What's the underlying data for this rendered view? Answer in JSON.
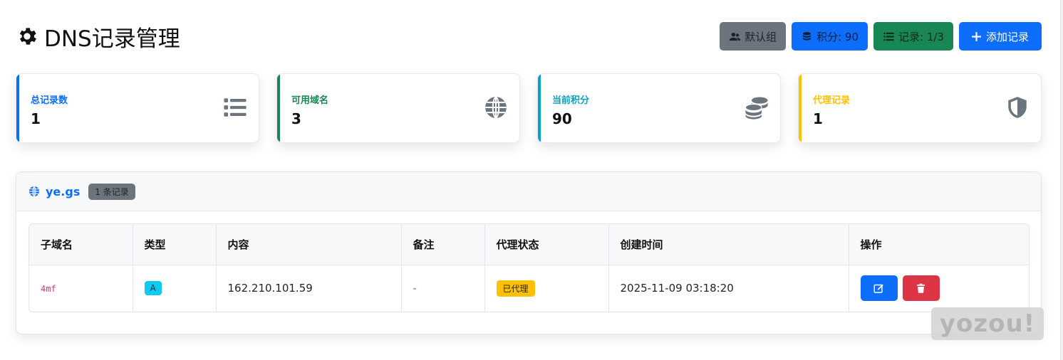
{
  "header": {
    "title": "DNS记录管理",
    "group_label": "默认组",
    "points_label": "积分: 90",
    "records_label": "记录: 1/3",
    "add_label": "添加记录"
  },
  "stats": [
    {
      "label": "总记录数",
      "value": "1",
      "color": "#0d6efd",
      "icon": "list-icon"
    },
    {
      "label": "可用域名",
      "value": "3",
      "color": "#198754",
      "icon": "globe-icon"
    },
    {
      "label": "当前积分",
      "value": "90",
      "color": "#0aa2c0",
      "icon": "coins-icon"
    },
    {
      "label": "代理记录",
      "value": "1",
      "color": "#ffc107",
      "icon": "shield-icon"
    }
  ],
  "domain_card": {
    "domain": "ye.gs",
    "count_label": "1 条记录",
    "columns": [
      "子域名",
      "类型",
      "内容",
      "备注",
      "代理状态",
      "创建时间",
      "操作"
    ],
    "rows": [
      {
        "subdomain": "4mf",
        "type": "A",
        "content": "162.210.101.59",
        "note": "-",
        "proxy": "已代理",
        "created": "2025-11-09 03:18:20"
      }
    ]
  },
  "watermark": "yozou!"
}
